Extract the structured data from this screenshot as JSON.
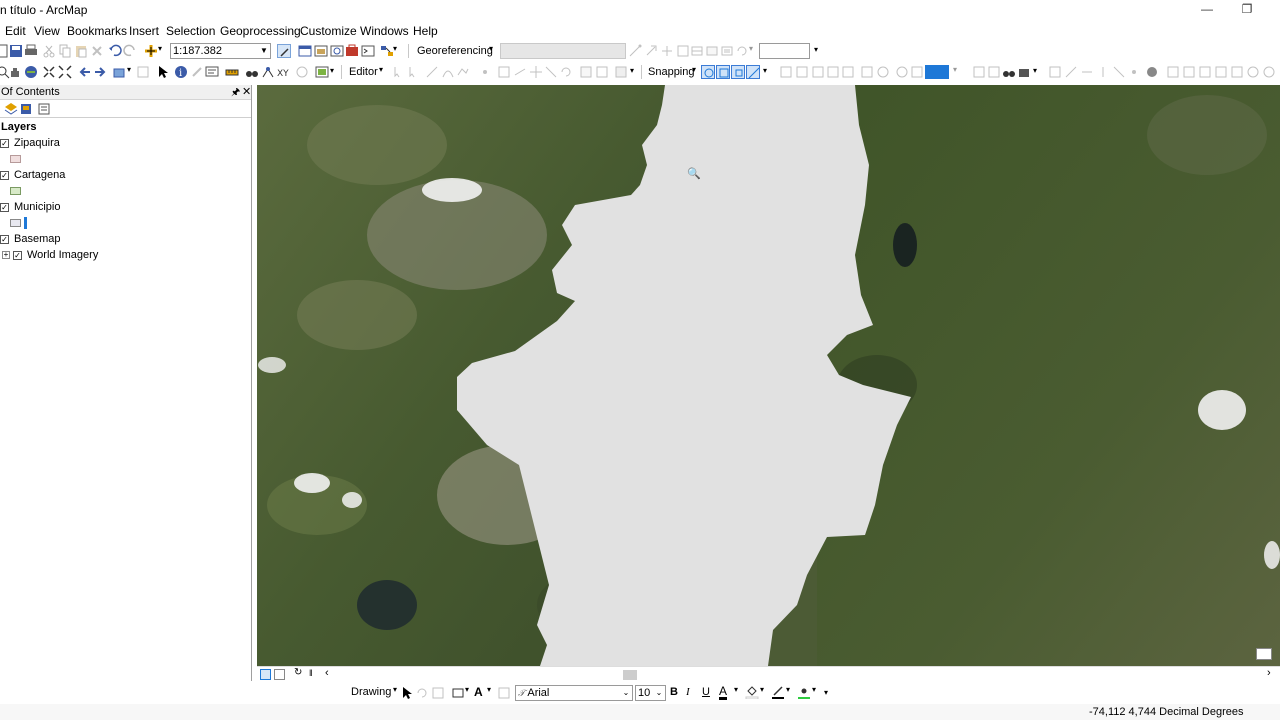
{
  "window": {
    "title": "n título - ArcMap"
  },
  "menu": [
    "Edit",
    "View",
    "Bookmarks",
    "Insert",
    "Selection",
    "Geoprocessing",
    "Customize",
    "Windows",
    "Help"
  ],
  "standard_toolbar": {
    "scale_value": "1:187.382"
  },
  "georeferencing": {
    "label": "Georeferencing",
    "layer_value": ""
  },
  "editor": {
    "label": "Editor"
  },
  "snapping": {
    "label": "Snapping"
  },
  "toc": {
    "title": "Of Contents",
    "root_label": "Layers",
    "layers": [
      {
        "name": "Zipaquira",
        "checked": true,
        "swatch": "#f0dede"
      },
      {
        "name": "Cartagena",
        "checked": true,
        "swatch": "#d8eac8"
      },
      {
        "name": "Municipio",
        "checked": true,
        "swatch": "#e8e8f0"
      },
      {
        "name": "Basemap",
        "checked": true,
        "swatch": ""
      },
      {
        "name": "World Imagery",
        "checked": true,
        "swatch": ""
      }
    ]
  },
  "drawing": {
    "label": "Drawing",
    "font_name": "Arial",
    "font_size": "10"
  },
  "status": {
    "coordinates": "-74,112  4,744 Decimal Degrees"
  },
  "colors": {
    "accent": "#1e78d7",
    "map_gap": "#e1e1e1"
  }
}
